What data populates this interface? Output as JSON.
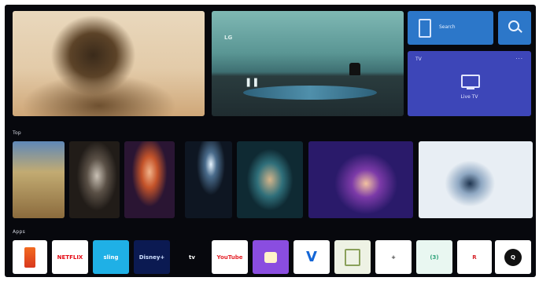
{
  "hero": {
    "brand_label": "LG",
    "pause_glyph": "❚❚",
    "search_tile_text": "Search",
    "tv_tile": {
      "header": "TV",
      "menu_glyph": "···",
      "caption": "Live TV"
    }
  },
  "sections": {
    "recommended_label": "Top",
    "apps_label": "Apps"
  },
  "apps": {
    "netflix": "NETFLIX",
    "sling": "sling",
    "disney": "Disney+",
    "appletv": "tv",
    "youtube": "YouTube",
    "vudu": "V",
    "amc": "+",
    "ch": "(3)",
    "rakuten": "R",
    "circle": "Q"
  },
  "colors": {
    "background": "#07080d",
    "search_tile": "#2c77c9",
    "tv_tile": "#3d46b8"
  }
}
